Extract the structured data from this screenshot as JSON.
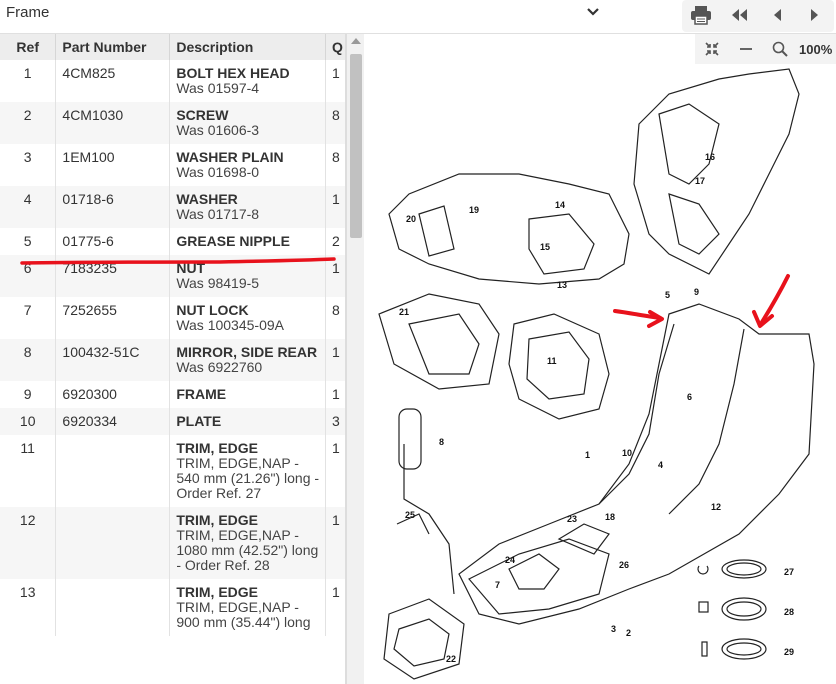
{
  "header": {
    "title": "Frame"
  },
  "toolbar": {
    "print_icon": "printer-icon",
    "first_icon": "first-page-icon",
    "prev_icon": "prev-icon",
    "next_icon": "next-icon"
  },
  "drawing_toolbar": {
    "zoom_label": "100%"
  },
  "table": {
    "columns": {
      "ref": "Ref",
      "part": "Part Number",
      "desc": "Description",
      "qty": "Q"
    },
    "rows": [
      {
        "ref": "1",
        "part": "4CM825",
        "desc": "BOLT HEX HEAD",
        "sub": "Was 01597-4",
        "qty": "1"
      },
      {
        "ref": "2",
        "part": "4CM1030",
        "desc": "SCREW",
        "sub": "Was 01606-3",
        "qty": "8"
      },
      {
        "ref": "3",
        "part": "1EM100",
        "desc": "WASHER PLAIN",
        "sub": "Was 01698-0",
        "qty": "8"
      },
      {
        "ref": "4",
        "part": "01718-6",
        "desc": "WASHER",
        "sub": "Was 01717-8",
        "qty": "1"
      },
      {
        "ref": "5",
        "part": "01775-6",
        "desc": "GREASE NIPPLE",
        "sub": "",
        "qty": "2"
      },
      {
        "ref": "6",
        "part": "7183235",
        "desc": "NUT",
        "sub": "Was 98419-5",
        "qty": "1"
      },
      {
        "ref": "7",
        "part": "7252655",
        "desc": "NUT LOCK",
        "sub": "Was 100345-09A",
        "qty": "8"
      },
      {
        "ref": "8",
        "part": "100432-51C",
        "desc": "MIRROR, SIDE REAR",
        "sub": "Was 6922760",
        "qty": "1"
      },
      {
        "ref": "9",
        "part": "6920300",
        "desc": "FRAME",
        "sub": "",
        "qty": "1"
      },
      {
        "ref": "10",
        "part": "6920334",
        "desc": "PLATE",
        "sub": "",
        "qty": "3"
      },
      {
        "ref": "11",
        "part": "",
        "desc": "TRIM, EDGE",
        "sub": "TRIM, EDGE,NAP - 540 mm (21.26\") long - Order Ref. 27",
        "qty": "1"
      },
      {
        "ref": "12",
        "part": "",
        "desc": "TRIM, EDGE",
        "sub": "TRIM, EDGE,NAP - 1080 mm (42.52\") long - Order Ref. 28",
        "qty": "1"
      },
      {
        "ref": "13",
        "part": "",
        "desc": "TRIM, EDGE",
        "sub": "TRIM, EDGE,NAP - 900 mm (35.44\") long",
        "qty": "1"
      }
    ]
  },
  "callouts": [
    "1",
    "2",
    "3",
    "4",
    "5",
    "6",
    "7",
    "8",
    "9",
    "10",
    "11",
    "12",
    "13",
    "14",
    "15",
    "16",
    "17",
    "18",
    "19",
    "20",
    "21",
    "22",
    "23",
    "24",
    "25",
    "26",
    "27",
    "28",
    "29"
  ],
  "colors": {
    "annotation": "#e8121c",
    "header_bg": "#ededed",
    "alt_row": "#f6f6f6"
  }
}
